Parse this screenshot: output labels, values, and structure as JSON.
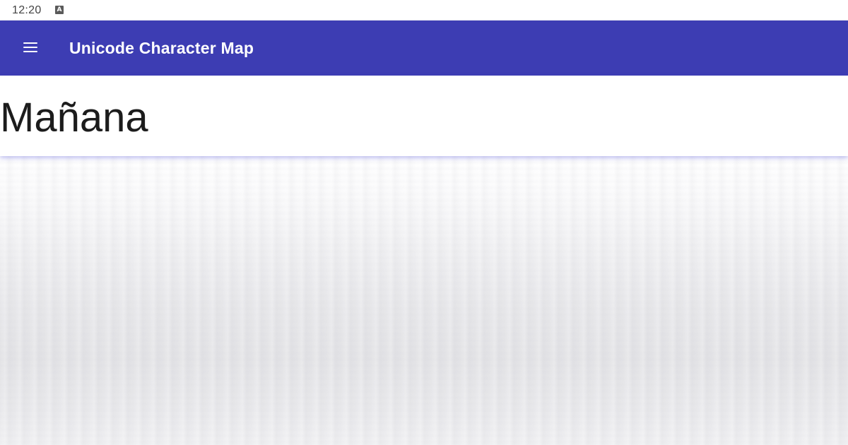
{
  "status_bar": {
    "time": "12:20",
    "notification_icon": "a-icon",
    "notification_glyph": "A"
  },
  "app_bar": {
    "title": "Unicode Character Map",
    "menu_icon": "menu-icon",
    "color": "#3d3db3"
  },
  "input": {
    "value": "Mañana"
  }
}
